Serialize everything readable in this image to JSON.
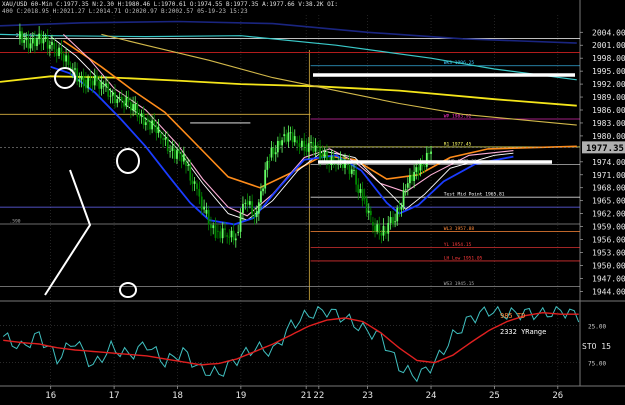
{
  "header": {
    "line1": "XAU/USD 60-Min C:1977.35 N:2.30 H:1980.46 L:1970.61 O:1974.55 B:1977.35 A:1977.66 V:38.2K OI:",
    "line2": "400 C:2018.95 H:2021.27 L:2014.71 O:2020.97 B:2002.57 05-19-23 15:23"
  },
  "chart_data": {
    "type": "line",
    "title": "",
    "instrument": "XAU/USD",
    "timeframe": "60-Min",
    "ohlc": {
      "close": 1977.35,
      "change": 2.3,
      "high": 1980.46,
      "low": 1970.61,
      "open": 1974.55,
      "bid": 1977.35,
      "ask": 1977.66
    },
    "volume": "38.2K",
    "ylim": [
      1942,
      2008
    ],
    "y_ticks": [
      2004.0,
      2001.0,
      1998.0,
      1995.0,
      1992.0,
      1989.0,
      1986.0,
      1983.0,
      1980.0,
      1977.35,
      1974.0,
      1971.0,
      1968.0,
      1965.0,
      1962.0,
      1959.0,
      1956.0,
      1953.0,
      1950.0,
      1947.0,
      1944.0
    ],
    "last_price": "1977.35",
    "x_ticks": [
      {
        "label": "16",
        "pos": 16
      },
      {
        "label": "17",
        "pos": 17
      },
      {
        "label": "18",
        "pos": 18
      },
      {
        "label": "19",
        "pos": 19
      },
      {
        "label": "21",
        "pos": 20.03
      },
      {
        "label": "22",
        "pos": 20.23
      },
      {
        "label": "23",
        "pos": 21.0
      },
      {
        "label": "24",
        "pos": 22.0
      },
      {
        "label": "25",
        "pos": 23.0
      },
      {
        "label": "26",
        "pos": 24.0
      }
    ],
    "xlim": [
      15.2,
      24.35
    ],
    "candle_x": [
      15.48,
      16.02,
      16.28,
      16.52,
      16.8,
      17.05,
      17.3,
      17.5,
      17.7,
      17.92,
      18.1,
      18.27,
      18.42,
      18.6,
      18.75,
      18.92,
      19.07,
      19.25,
      19.45,
      19.65,
      19.85,
      20.0,
      20.25,
      20.5,
      20.75,
      20.92,
      21.05,
      21.25,
      21.4,
      21.6,
      21.8,
      22.0
    ],
    "candle_close": [
      2002.5,
      2001.5,
      1996,
      1993,
      1991.5,
      1989,
      1986,
      1984,
      1980.5,
      1977,
      1974,
      1969,
      1962,
      1958,
      1957,
      1957.5,
      1965,
      1962,
      1975,
      1980,
      1979,
      1978,
      1976,
      1974,
      1972,
      1966,
      1960,
      1958,
      1960,
      1968,
      1972,
      1977.35
    ],
    "levels": [
      {
        "label": "2002.57",
        "value": 2002.57,
        "color": "#ffffff"
      },
      {
        "label": "WK3 1996.25",
        "value": 1996.25,
        "color": "#3ec8ff"
      },
      {
        "label": "WP 1983.92",
        "value": 1983.92,
        "color": "#ff33cc"
      },
      {
        "label": "R1 1977.45",
        "value": 1977.45,
        "color": "#ffff66"
      },
      {
        "label": "S5WR 1973.35",
        "value": 1973.35,
        "color": "#dddddd"
      },
      {
        "label": "Test Mid Point 1965.81",
        "value": 1965.81,
        "color": "#ffffff"
      },
      {
        "label": "WL3 1957.88",
        "value": 1957.88,
        "color": "#ff8a3a"
      },
      {
        "label": "YL 1954.15",
        "value": 1954.15,
        "color": "#ff3b3b"
      },
      {
        "label": "LH Low 1951.05",
        "value": 1951.05,
        "color": "#ff3b3b"
      },
      {
        "label": "WS3 1945.15",
        "value": 1945.15,
        "color": "#aaaaaa"
      },
      {
        "label": ".590",
        "value": 1959.6,
        "color": "#aaaaaa"
      }
    ],
    "indicator": {
      "name": "STO",
      "period": "15",
      "ylim": [
        -5,
        105
      ],
      "y_ticks": [
        {
          "label": "25.00",
          "value": 75
        },
        {
          "label": "75.00",
          "value": 25
        }
      ],
      "annotations": [
        "985 TD",
        "2332 YRange"
      ],
      "fast": [
        60,
        45,
        62,
        30,
        55,
        20,
        45,
        35,
        50,
        25,
        40,
        15,
        10,
        30,
        45,
        40,
        75,
        90,
        95,
        85,
        70,
        60,
        20,
        5,
        25,
        60,
        85,
        95,
        90,
        92,
        90,
        95,
        88
      ],
      "slow": [
        55,
        52,
        50,
        45,
        42,
        40,
        38,
        36,
        34,
        30,
        26,
        22,
        24,
        30,
        40,
        50,
        62,
        74,
        82,
        85,
        80,
        65,
        45,
        28,
        25,
        35,
        52,
        68,
        80,
        88,
        92,
        90,
        90
      ]
    }
  },
  "colors": {
    "background": "#000000",
    "candle_up": "#66ff66",
    "candle_down": "#008800",
    "ma_blue": "#1a3cff",
    "ma_orange": "#ff8c1a",
    "ma_yellow": "#f5e61a",
    "ma_gold": "#d2b84a",
    "ma_pink": "#ffb0d8",
    "ma_white": "#ffffff",
    "ma_navy": "#1a2580",
    "ma_teal": "#39c8c8",
    "sto_fast": "#40c0c0",
    "sto_slow": "#e02020",
    "last_price_bg": "#b0b0b0",
    "annot": "#ffffff"
  }
}
